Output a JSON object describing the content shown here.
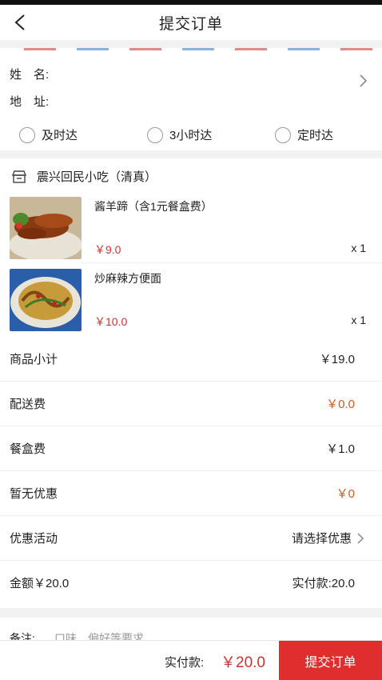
{
  "header": {
    "title": "提交订单",
    "back_icon": "chevron-left-icon"
  },
  "address": {
    "name_label": "姓　名:",
    "addr_label": "地　址:",
    "arrow_icon": "chevron-right-icon"
  },
  "delivery": {
    "options": [
      "及时达",
      "3小时达",
      "定时达"
    ]
  },
  "shop": {
    "name": "震兴回民小吃（清真）",
    "icon": "store-icon",
    "items": [
      {
        "name": "酱羊蹄（含1元餐盒费）",
        "price": "￥9.0",
        "qty": "x 1"
      },
      {
        "name": "炒麻辣方便面",
        "price": "￥10.0",
        "qty": "x 1"
      }
    ]
  },
  "summary": {
    "rows": [
      {
        "label": "商品小计",
        "value": "￥19.0"
      },
      {
        "label": "配送费",
        "value": "￥0.0"
      },
      {
        "label": "餐盒费",
        "value": "￥1.0"
      },
      {
        "label": "暂无优惠",
        "value": "￥0"
      },
      {
        "label": "优惠活动",
        "value": "请选择优惠"
      },
      {
        "label": "金额￥20.0",
        "value": "实付款:20.0"
      }
    ]
  },
  "note": {
    "label": "备注:",
    "placeholder": "口味、偏好等要求"
  },
  "bottom": {
    "pay_label": "实付款:",
    "pay_value": "￥20.0",
    "submit_label": "提交订单"
  },
  "colors": {
    "accent_red": "#e02e2e",
    "price_red": "#d2322d",
    "orange": "#cc5a1c"
  }
}
